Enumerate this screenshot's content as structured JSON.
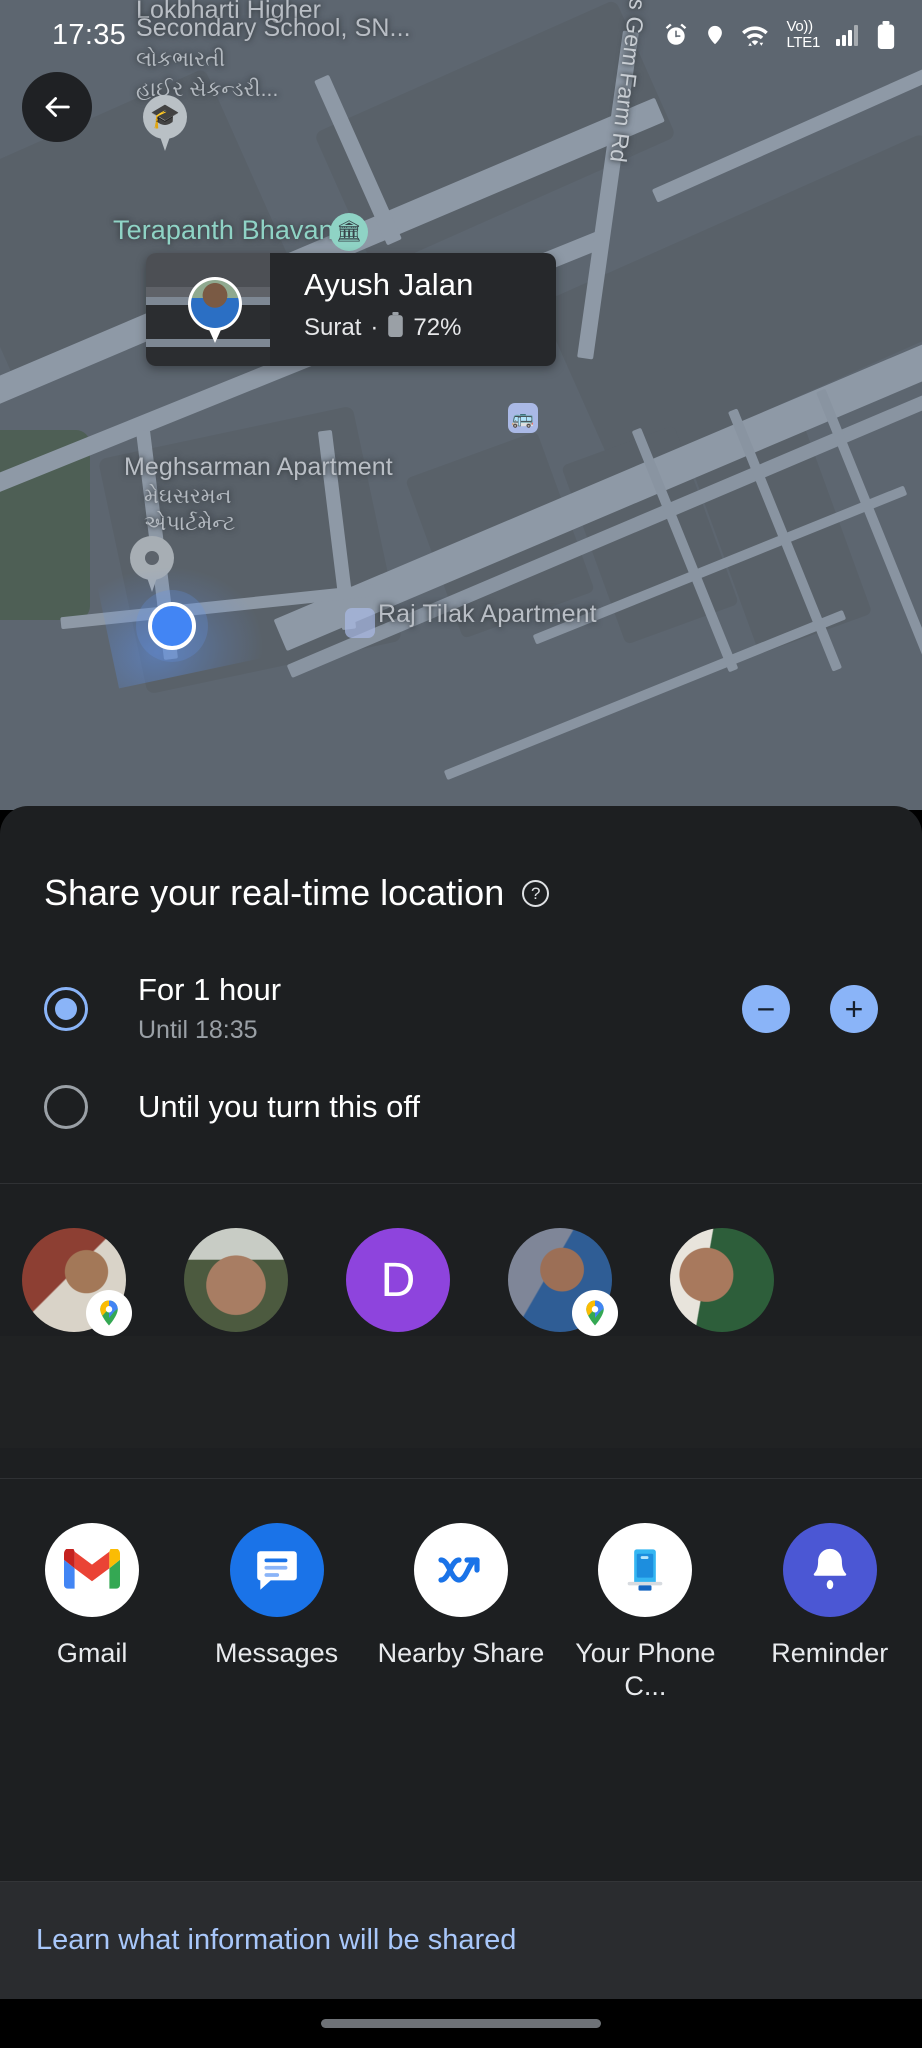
{
  "status_bar": {
    "time": "17:35",
    "icons": [
      "alarm-icon",
      "location-icon",
      "wifi-icon",
      "volte-icon",
      "signal-icon",
      "battery-icon"
    ],
    "network_line1": "Vo))",
    "network_line2": "LTE1"
  },
  "map": {
    "back_label": "←",
    "labels": [
      {
        "text": "Lokbharti Higher",
        "type": "poi"
      },
      {
        "text": "Secondary School, SN...",
        "type": "poi"
      },
      {
        "text": "લોકભારતી",
        "type": "poi-local"
      },
      {
        "text": "હાઈર સેકન્ડરી...",
        "type": "poi-local"
      },
      {
        "text": "Terapanth Bhavan",
        "type": "teal"
      },
      {
        "text": "Meghsarman Apartment",
        "type": "poi"
      },
      {
        "text": "મેઘસરમન",
        "type": "poi-local"
      },
      {
        "text": "એપાર્ટમેન્ટ",
        "type": "poi-local"
      },
      {
        "text": "Raj Tilak Apartment",
        "type": "poi"
      },
      {
        "text": "s Gem Farm Rd",
        "type": "road-vertical"
      }
    ]
  },
  "person_card": {
    "name": "Ayush Jalan",
    "city": "Surat",
    "separator": "·",
    "battery": "72%"
  },
  "sheet": {
    "title": "Share your real-time location",
    "help_icon": "?",
    "options": [
      {
        "title": "For 1 hour",
        "subtitle": "Until 18:35",
        "selected": true
      },
      {
        "title": "Until you turn this off",
        "subtitle": "",
        "selected": false
      }
    ],
    "stepper": {
      "decrease": "−",
      "increase": "+"
    }
  },
  "contacts": [
    {
      "type": "photo",
      "initial": "",
      "color": "#8d7360",
      "has_maps_badge": true
    },
    {
      "type": "photo",
      "initial": "",
      "color": "#6d7a5c",
      "has_maps_badge": false
    },
    {
      "type": "initial",
      "initial": "D",
      "color": "#8e44dd",
      "has_maps_badge": false
    },
    {
      "type": "photo",
      "initial": "",
      "color": "#74788c",
      "has_maps_badge": true
    },
    {
      "type": "photo",
      "initial": "",
      "color": "#586047",
      "has_maps_badge": false
    }
  ],
  "apps": [
    {
      "label": "Gmail",
      "icon": "gmail-icon"
    },
    {
      "label": "Messages",
      "icon": "messages-icon"
    },
    {
      "label": "Nearby Share",
      "icon": "nearby-share-icon"
    },
    {
      "label": "Your Phone C...",
      "icon": "your-phone-companion-icon"
    },
    {
      "label": "Reminder",
      "icon": "reminder-icon"
    }
  ],
  "footer": {
    "learn_link": "Learn what information will be shared"
  },
  "colors": {
    "accent_blue": "#8ab4f8",
    "link_blue": "#a8c7fa",
    "sheet_bg": "#1d1f21",
    "map_bg": "#5d6670",
    "teal_poi": "#8fd3c5",
    "purple_avatar": "#8e44dd"
  }
}
